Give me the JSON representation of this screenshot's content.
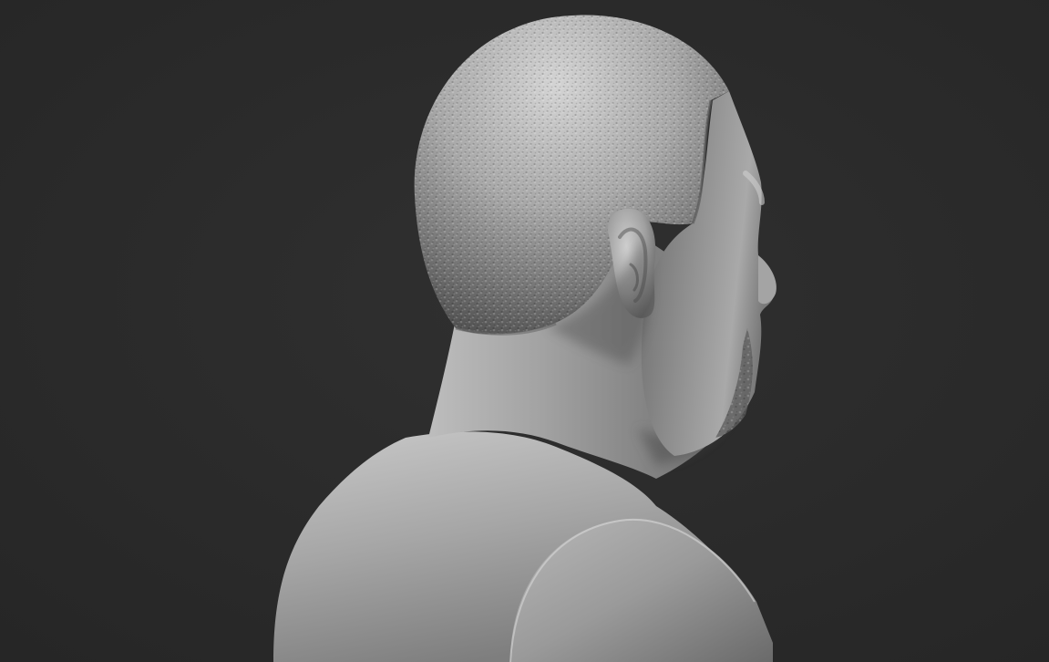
{
  "scene": {
    "subject": "sculpted-bust-rear-three-quarter-view",
    "colors": {
      "background": "#2b2b2b",
      "background_vignette": "#232323",
      "clay_light": "#d2d2d2",
      "clay_mid": "#9a9a9a",
      "clay_dark": "#4a4a4a"
    }
  }
}
